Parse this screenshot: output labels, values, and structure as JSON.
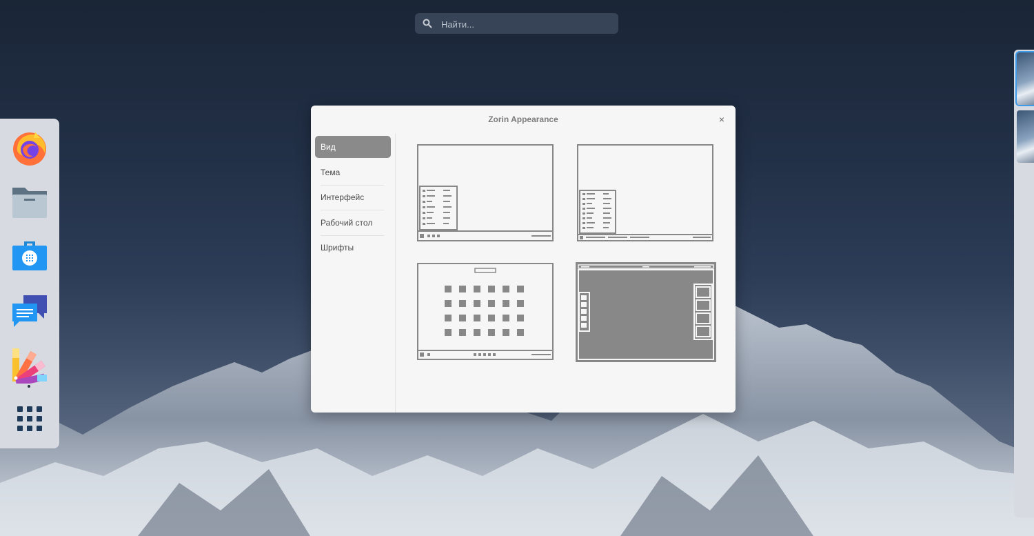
{
  "search": {
    "placeholder": "Найти..."
  },
  "dock": {
    "items": [
      {
        "name": "firefox-icon"
      },
      {
        "name": "files-icon"
      },
      {
        "name": "software-store-icon"
      },
      {
        "name": "messages-icon"
      },
      {
        "name": "appearance-icon",
        "running": true
      },
      {
        "name": "show-apps-icon"
      }
    ]
  },
  "window": {
    "title": "Zorin Appearance",
    "close_label": "×",
    "sidebar": {
      "items": [
        {
          "label": "Вид",
          "active": true
        },
        {
          "label": "Тема"
        },
        {
          "label": "Интерфейс"
        },
        {
          "label": "Рабочий стол"
        },
        {
          "label": "Шрифты"
        }
      ]
    },
    "layouts": [
      {
        "name": "layout-windows-like",
        "selected": false
      },
      {
        "name": "layout-windows-classic",
        "selected": false
      },
      {
        "name": "layout-gnome-like",
        "selected": false
      },
      {
        "name": "layout-touch",
        "selected": true
      }
    ]
  },
  "colors": {
    "active_item": "#8a8a8a",
    "window_bg": "#f6f6f6",
    "workspace_highlight": "#3d9be9"
  }
}
